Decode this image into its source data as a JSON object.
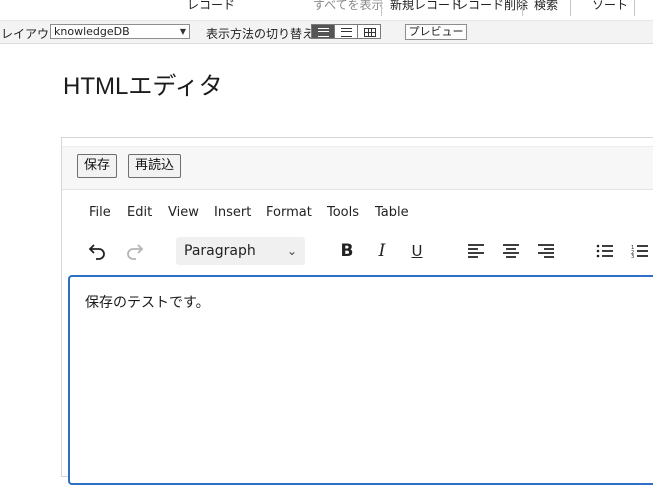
{
  "fm_toolbar": {
    "record_label": "レコード",
    "show_all": "すべてを表示",
    "new_record": "新規レコード",
    "delete_record": "レコード削除",
    "find": "検索",
    "sort": "ソート"
  },
  "layout_bar": {
    "layout_label": "レイアウト:",
    "layout_value": "knowledgeDB",
    "view_label": "表示方法の切り替え:",
    "preview_label": "プレビュー"
  },
  "page": {
    "title": "HTMLエディタ"
  },
  "card": {
    "save_button": "保存",
    "reload_button": "再読込"
  },
  "editor_menu": [
    "File",
    "Edit",
    "View",
    "Insert",
    "Format",
    "Tools",
    "Table"
  ],
  "editor_toolbar": {
    "block_format": "Paragraph",
    "icons": [
      "undo-icon",
      "redo-icon",
      "bold-icon",
      "italic-icon",
      "underline-icon",
      "align-left-icon",
      "align-center-icon",
      "align-right-icon",
      "bullet-list-icon",
      "numbered-list-icon"
    ]
  },
  "editor": {
    "content": "保存のテストです。"
  }
}
